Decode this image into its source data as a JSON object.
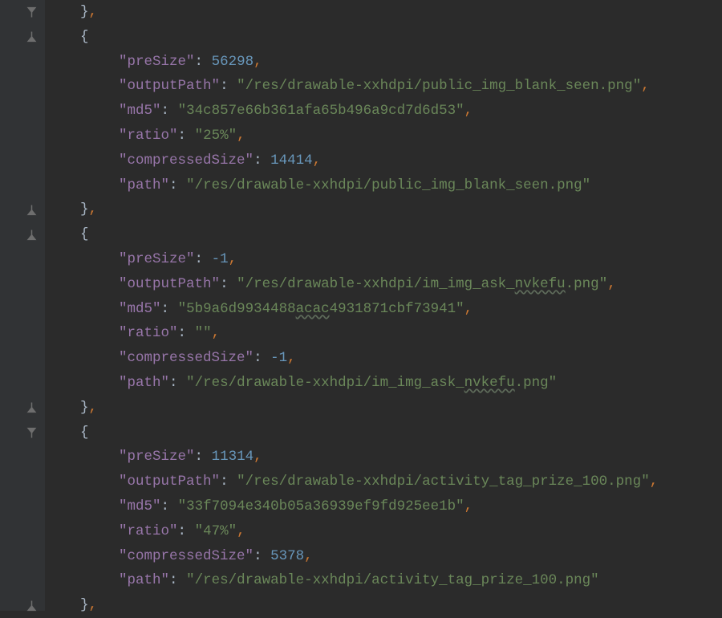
{
  "keys": {
    "preSize": "preSize",
    "outputPath": "outputPath",
    "md5": "md5",
    "ratio": "ratio",
    "compressedSize": "compressedSize",
    "path": "path"
  },
  "blocks": [
    {
      "preSize": "56298",
      "outputPath": "/res/drawable-xxhdpi/public_img_blank_seen.png",
      "md5": "34c857e66b361afa65b496a9cd7d6d53",
      "ratio": "25%",
      "compressedSize": "14414",
      "path": "/res/drawable-xxhdpi/public_img_blank_seen.png"
    },
    {
      "preSize": "-1",
      "outputPath": "/res/drawable-xxhdpi/im_img_ask_nvkefu.png",
      "outputPath_pre": "/res/drawable-xxhdpi/im_img_ask_",
      "outputPath_wavy": "nvkefu",
      "outputPath_post": ".png",
      "md5": "5b9a6d9934488acac4931871cbf73941",
      "md5_pre": "5b9a6d9934488",
      "md5_wavy": "acac",
      "md5_post": "4931871cbf73941",
      "ratio": "",
      "compressedSize": "-1",
      "path": "/res/drawable-xxhdpi/im_img_ask_nvkefu.png",
      "path_pre": "/res/drawable-xxhdpi/im_img_ask_",
      "path_wavy": "nvkefu",
      "path_post": ".png"
    },
    {
      "preSize": "11314",
      "outputPath": "/res/drawable-xxhdpi/activity_tag_prize_100.png",
      "md5": "33f7094e340b05a36939ef9fd925ee1b",
      "ratio": "47%",
      "compressedSize": "5378",
      "path": "/res/drawable-xxhdpi/activity_tag_prize_100.png"
    }
  ]
}
